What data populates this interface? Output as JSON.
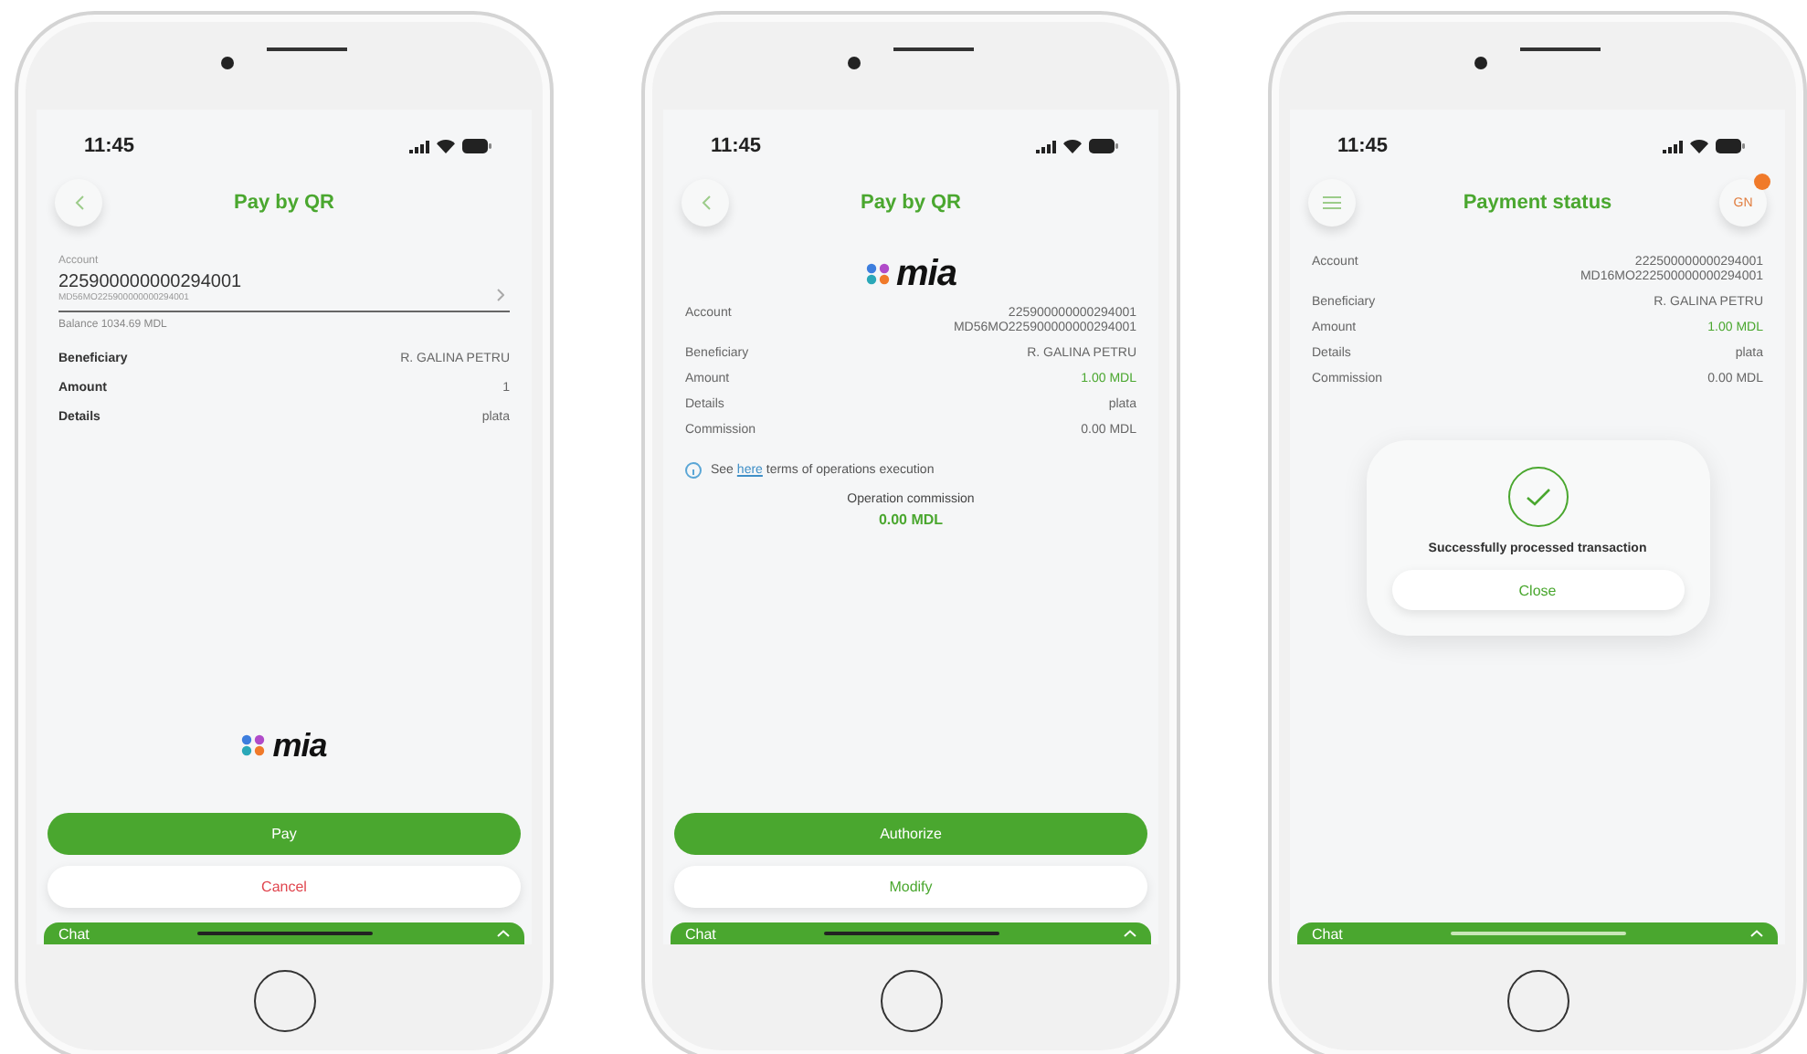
{
  "phones": [
    {
      "kind": "form",
      "status_bar": {
        "time": "11:45"
      },
      "header": {
        "kind": "back",
        "title": "Pay by QR"
      },
      "body": [
        {
          "kind": "account_field",
          "label": "Account",
          "number": "225900000000294001",
          "iban": "MD56MO225900000000294001",
          "balance": "Balance 1034.69 MDL"
        },
        {
          "kind": "details",
          "rows": [
            {
              "label": "Beneficiary",
              "value": "R. GALINA PETRU",
              "accent": false
            },
            {
              "label": "Amount",
              "value": "1",
              "accent": false
            },
            {
              "label": "Details",
              "value": "plata",
              "accent": false
            }
          ]
        }
      ],
      "footer": {
        "logo": {
          "text": "mia"
        },
        "buttons": [
          {
            "label": "Pay",
            "kind": "primary"
          },
          {
            "label": "Cancel",
            "kind": "danger"
          }
        ]
      },
      "chat": {
        "label": "Chat"
      }
    },
    {
      "kind": "confirm",
      "status_bar": {
        "time": "11:45"
      },
      "header": {
        "kind": "back",
        "title": "Pay by QR"
      },
      "body": [
        {
          "kind": "logo",
          "text": "mia"
        },
        {
          "kind": "details",
          "rows": [
            {
              "label": "Account",
              "value": "225900000000294001",
              "subvalue": "MD56MO225900000000294001",
              "accent": false
            },
            {
              "label": "Beneficiary",
              "value": "R. GALINA PETRU",
              "accent": false
            },
            {
              "label": "Amount",
              "value": "1.00 MDL",
              "accent": true
            },
            {
              "label": "Details",
              "value": "plata",
              "accent": false
            },
            {
              "label": "Commission",
              "value": "0.00 MDL",
              "accent": false
            }
          ]
        },
        {
          "kind": "info",
          "before": "See",
          "link": "here",
          "after": "terms of operations execution"
        },
        {
          "kind": "commission",
          "label": "Operation commission",
          "value": "0.00 MDL"
        }
      ],
      "footer": {
        "buttons": [
          {
            "label": "Authorize",
            "kind": "primary"
          },
          {
            "label": "Modify",
            "kind": "secondary"
          }
        ]
      },
      "chat": {
        "label": "Chat"
      }
    },
    {
      "kind": "status",
      "status_bar": {
        "time": "11:45"
      },
      "header": {
        "kind": "menu",
        "title": "Payment status",
        "avatar": "GN"
      },
      "body": [
        {
          "kind": "details",
          "rows": [
            {
              "label": "Account",
              "value": "222500000000294001",
              "subvalue": "MD16MO222500000000294001",
              "accent": false
            },
            {
              "label": "Beneficiary",
              "value": "R. GALINA PETRU",
              "accent": false
            },
            {
              "label": "Amount",
              "value": "1.00 MDL",
              "accent": true
            },
            {
              "label": "Details",
              "value": "plata",
              "accent": false
            },
            {
              "label": "Commission",
              "value": "0.00 MDL",
              "accent": false
            }
          ]
        },
        {
          "kind": "dialog",
          "message": "Successfully processed transaction",
          "button": "Close"
        }
      ],
      "chat": {
        "label": "Chat"
      }
    }
  ]
}
